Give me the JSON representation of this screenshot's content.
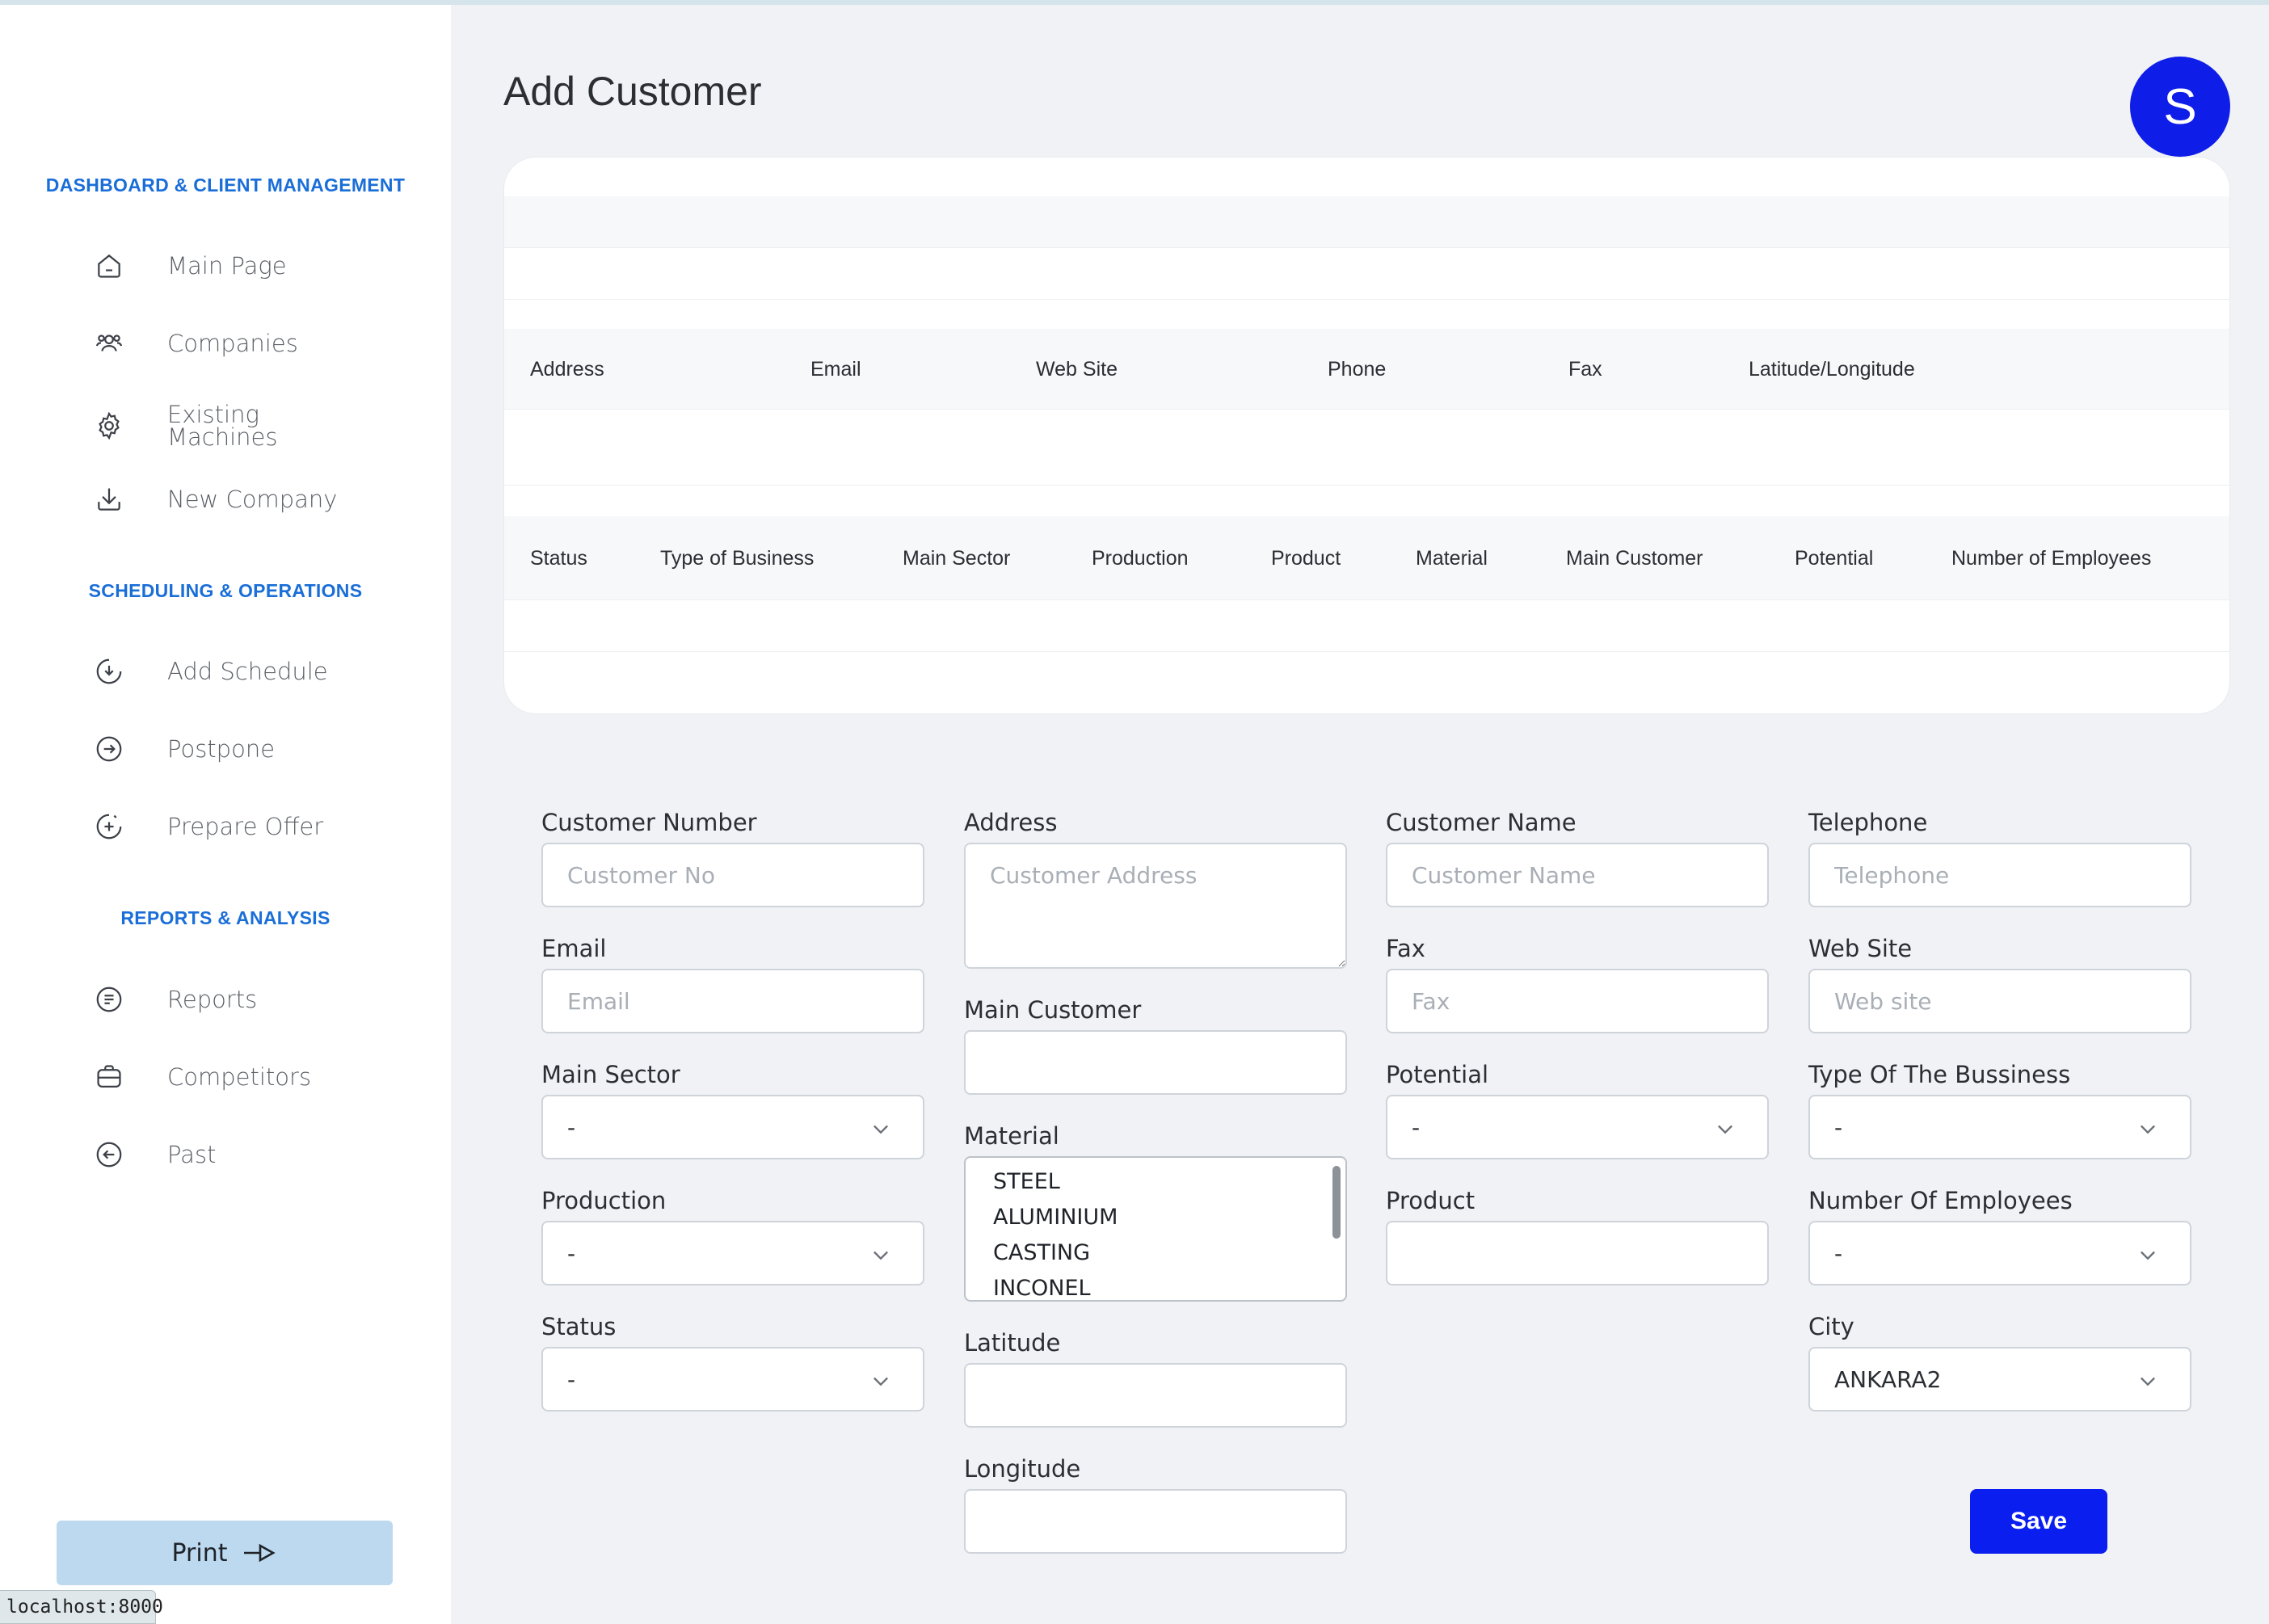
{
  "app": {
    "title": "Add Customer",
    "avatar_initial": "S",
    "status_url": "localhost:8000"
  },
  "sidebar": {
    "sections": [
      {
        "title": "DASHBOARD & CLIENT MANAGEMENT",
        "items": [
          {
            "label": "Main Page",
            "icon": "home-icon"
          },
          {
            "label": "Companies",
            "icon": "users-icon"
          },
          {
            "label": "Existing\nMachines",
            "icon": "gear-icon"
          },
          {
            "label": "New Company",
            "icon": "download-icon"
          }
        ]
      },
      {
        "title": "SCHEDULING & OPERATIONS",
        "items": [
          {
            "label": "Add Schedule",
            "icon": "clock-down-icon"
          },
          {
            "label": "Postpone",
            "icon": "arrow-right-circle-icon"
          },
          {
            "label": "Prepare Offer",
            "icon": "clock-plus-icon"
          }
        ]
      },
      {
        "title": "REPORTS & ANALYSIS",
        "items": [
          {
            "label": "Reports",
            "icon": "report-icon"
          },
          {
            "label": "Competitors",
            "icon": "briefcase-icon"
          },
          {
            "label": "Past",
            "icon": "arrow-left-circle-icon"
          }
        ]
      }
    ],
    "print_label": "Print"
  },
  "table": {
    "header_row_1": [
      "Address",
      "Email",
      "Web Site",
      "Phone",
      "Fax",
      "Latitude/Longitude"
    ],
    "header_row_2": [
      "Status",
      "Type of Business",
      "Main Sector",
      "Production",
      "Product",
      "Material",
      "Main Customer",
      "Potential",
      "Number of Employees"
    ]
  },
  "form": {
    "customer_number": {
      "label": "Customer Number",
      "placeholder": "Customer No"
    },
    "address": {
      "label": "Address",
      "placeholder": "Customer Address"
    },
    "customer_name": {
      "label": "Customer Name",
      "placeholder": "Customer Name"
    },
    "telephone": {
      "label": "Telephone",
      "placeholder": "Telephone"
    },
    "email": {
      "label": "Email",
      "placeholder": "Email"
    },
    "fax": {
      "label": "Fax",
      "placeholder": "Fax"
    },
    "web_site": {
      "label": "Web Site",
      "placeholder": "Web site"
    },
    "main_customer": {
      "label": "Main Customer"
    },
    "main_sector": {
      "label": "Main Sector",
      "value": "-"
    },
    "potential": {
      "label": "Potential",
      "value": "-"
    },
    "type_of_business": {
      "label": "Type Of The Bussiness",
      "value": "-"
    },
    "material": {
      "label": "Material",
      "options": [
        "STEEL",
        "ALUMINIUM",
        "CASTING",
        "INCONEL"
      ]
    },
    "production": {
      "label": "Production",
      "value": "-"
    },
    "product": {
      "label": "Product"
    },
    "number_of_employees": {
      "label": "Number Of Employees",
      "value": "-"
    },
    "status": {
      "label": "Status",
      "value": "-"
    },
    "latitude": {
      "label": "Latitude"
    },
    "city": {
      "label": "City",
      "value": "ANKARA2"
    },
    "longitude": {
      "label": "Longitude"
    },
    "save_label": "Save"
  },
  "colors": {
    "accent": "#0b1ef0",
    "section_title": "#1a6ed8",
    "print_button": "#bcd9ef"
  }
}
